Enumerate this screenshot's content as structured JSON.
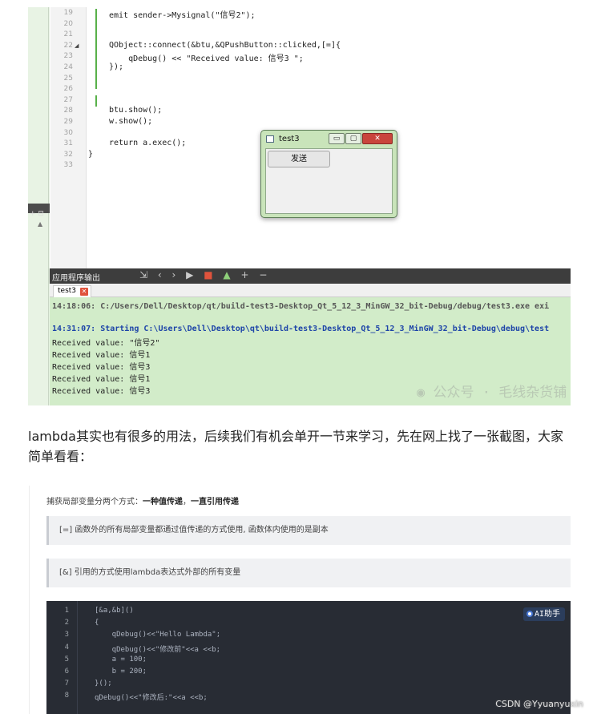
{
  "ide": {
    "code_lines": [
      {
        "num": "19",
        "text": "emit sender->Mysignal(\"信号2\");"
      },
      {
        "num": "20",
        "text": ""
      },
      {
        "num": "21",
        "text": ""
      },
      {
        "num": "22",
        "text": "QObject::connect(&btu,&QPushButton::clicked,[=]{"
      },
      {
        "num": "23",
        "text": "    qDebug() << \"Received value: 信号3 \";"
      },
      {
        "num": "24",
        "text": "});"
      },
      {
        "num": "25",
        "text": ""
      },
      {
        "num": "26",
        "text": ""
      },
      {
        "num": "27",
        "text": ""
      },
      {
        "num": "28",
        "text": "btu.show();"
      },
      {
        "num": "29",
        "text": "w.show();"
      },
      {
        "num": "30",
        "text": ""
      },
      {
        "num": "31",
        "text": "return a.exec();"
      },
      {
        "num": "32",
        "text": "}"
      },
      {
        "num": "33",
        "text": ""
      }
    ],
    "window": {
      "title": "test3",
      "button_label": "发送",
      "min": "▭",
      "max": "▢",
      "close": "✕"
    },
    "output_panel": {
      "title": "应用程序输出",
      "tab": "test3",
      "lines": [
        "14:18:06: C:/Users/Dell/Desktop/qt/build-test3-Desktop_Qt_5_12_3_MinGW_32_bit-Debug/debug/test3.exe exi",
        "",
        "14:31:07: Starting C:\\Users\\Dell\\Desktop\\qt\\build-test3-Desktop_Qt_5_12_3_MinGW_32_bit-Debug\\debug\\test",
        "Received value: \"信号2\"",
        "Received value: 信号1",
        "Received value: 信号3",
        "Received value: 信号1",
        "Received value: 信号3"
      ],
      "watermark": "公众号 · 毛线杂货铺"
    },
    "sidebar_split": "+ ⊟"
  },
  "paragraph": "lambda其实也有很多的用法，后续我们有机会单开一节来学习，先在网上找了一张截图，大家简单看看：",
  "shot2": {
    "intro_prefix": "捕获局部变量分两个方式：",
    "intro_bold1": "一种值传递",
    "intro_mid": "，",
    "intro_bold2": "一直引用传递",
    "quote1": "[=] 函数外的所有局部变量都通过值传递的方式使用, 函数体内使用的是副本",
    "quote2": "[&] 引用的方式使用lambda表达式外部的所有变量",
    "code": [
      {
        "n": "1",
        "t": "[&a,&b]()"
      },
      {
        "n": "2",
        "t": "{"
      },
      {
        "n": "3",
        "t": "    qDebug()<<\"Hello Lambda\";"
      },
      {
        "n": "4",
        "t": "    qDebug()<<\"修改前\"<<a <<b;"
      },
      {
        "n": "5",
        "t": "    a = 100;"
      },
      {
        "n": "6",
        "t": "    b = 200;"
      },
      {
        "n": "7",
        "t": "}();"
      },
      {
        "n": "8",
        "t": "qDebug()<<\"修改后:\"<<a <<b;"
      }
    ],
    "ai_label": "AI助手"
  },
  "csdn": "CSDN @Yyuanyuxin"
}
